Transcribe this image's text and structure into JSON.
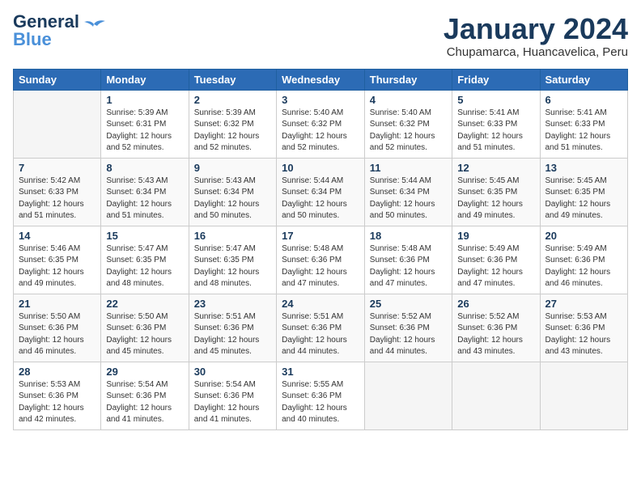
{
  "logo": {
    "line1": "General",
    "line2": "Blue"
  },
  "title": "January 2024",
  "location": "Chupamarca, Huancavelica, Peru",
  "weekdays": [
    "Sunday",
    "Monday",
    "Tuesday",
    "Wednesday",
    "Thursday",
    "Friday",
    "Saturday"
  ],
  "weeks": [
    [
      {
        "day": "",
        "empty": true
      },
      {
        "day": "1",
        "sunrise": "5:39 AM",
        "sunset": "6:31 PM",
        "daylight": "12 hours and 52 minutes."
      },
      {
        "day": "2",
        "sunrise": "5:39 AM",
        "sunset": "6:32 PM",
        "daylight": "12 hours and 52 minutes."
      },
      {
        "day": "3",
        "sunrise": "5:40 AM",
        "sunset": "6:32 PM",
        "daylight": "12 hours and 52 minutes."
      },
      {
        "day": "4",
        "sunrise": "5:40 AM",
        "sunset": "6:32 PM",
        "daylight": "12 hours and 52 minutes."
      },
      {
        "day": "5",
        "sunrise": "5:41 AM",
        "sunset": "6:33 PM",
        "daylight": "12 hours and 51 minutes."
      },
      {
        "day": "6",
        "sunrise": "5:41 AM",
        "sunset": "6:33 PM",
        "daylight": "12 hours and 51 minutes."
      }
    ],
    [
      {
        "day": "7",
        "sunrise": "5:42 AM",
        "sunset": "6:33 PM",
        "daylight": "12 hours and 51 minutes."
      },
      {
        "day": "8",
        "sunrise": "5:43 AM",
        "sunset": "6:34 PM",
        "daylight": "12 hours and 51 minutes."
      },
      {
        "day": "9",
        "sunrise": "5:43 AM",
        "sunset": "6:34 PM",
        "daylight": "12 hours and 50 minutes."
      },
      {
        "day": "10",
        "sunrise": "5:44 AM",
        "sunset": "6:34 PM",
        "daylight": "12 hours and 50 minutes."
      },
      {
        "day": "11",
        "sunrise": "5:44 AM",
        "sunset": "6:34 PM",
        "daylight": "12 hours and 50 minutes."
      },
      {
        "day": "12",
        "sunrise": "5:45 AM",
        "sunset": "6:35 PM",
        "daylight": "12 hours and 49 minutes."
      },
      {
        "day": "13",
        "sunrise": "5:45 AM",
        "sunset": "6:35 PM",
        "daylight": "12 hours and 49 minutes."
      }
    ],
    [
      {
        "day": "14",
        "sunrise": "5:46 AM",
        "sunset": "6:35 PM",
        "daylight": "12 hours and 49 minutes."
      },
      {
        "day": "15",
        "sunrise": "5:47 AM",
        "sunset": "6:35 PM",
        "daylight": "12 hours and 48 minutes."
      },
      {
        "day": "16",
        "sunrise": "5:47 AM",
        "sunset": "6:35 PM",
        "daylight": "12 hours and 48 minutes."
      },
      {
        "day": "17",
        "sunrise": "5:48 AM",
        "sunset": "6:36 PM",
        "daylight": "12 hours and 47 minutes."
      },
      {
        "day": "18",
        "sunrise": "5:48 AM",
        "sunset": "6:36 PM",
        "daylight": "12 hours and 47 minutes."
      },
      {
        "day": "19",
        "sunrise": "5:49 AM",
        "sunset": "6:36 PM",
        "daylight": "12 hours and 47 minutes."
      },
      {
        "day": "20",
        "sunrise": "5:49 AM",
        "sunset": "6:36 PM",
        "daylight": "12 hours and 46 minutes."
      }
    ],
    [
      {
        "day": "21",
        "sunrise": "5:50 AM",
        "sunset": "6:36 PM",
        "daylight": "12 hours and 46 minutes."
      },
      {
        "day": "22",
        "sunrise": "5:50 AM",
        "sunset": "6:36 PM",
        "daylight": "12 hours and 45 minutes."
      },
      {
        "day": "23",
        "sunrise": "5:51 AM",
        "sunset": "6:36 PM",
        "daylight": "12 hours and 45 minutes."
      },
      {
        "day": "24",
        "sunrise": "5:51 AM",
        "sunset": "6:36 PM",
        "daylight": "12 hours and 44 minutes."
      },
      {
        "day": "25",
        "sunrise": "5:52 AM",
        "sunset": "6:36 PM",
        "daylight": "12 hours and 44 minutes."
      },
      {
        "day": "26",
        "sunrise": "5:52 AM",
        "sunset": "6:36 PM",
        "daylight": "12 hours and 43 minutes."
      },
      {
        "day": "27",
        "sunrise": "5:53 AM",
        "sunset": "6:36 PM",
        "daylight": "12 hours and 43 minutes."
      }
    ],
    [
      {
        "day": "28",
        "sunrise": "5:53 AM",
        "sunset": "6:36 PM",
        "daylight": "12 hours and 42 minutes."
      },
      {
        "day": "29",
        "sunrise": "5:54 AM",
        "sunset": "6:36 PM",
        "daylight": "12 hours and 41 minutes."
      },
      {
        "day": "30",
        "sunrise": "5:54 AM",
        "sunset": "6:36 PM",
        "daylight": "12 hours and 41 minutes."
      },
      {
        "day": "31",
        "sunrise": "5:55 AM",
        "sunset": "6:36 PM",
        "daylight": "12 hours and 40 minutes."
      },
      {
        "day": "",
        "empty": true
      },
      {
        "day": "",
        "empty": true
      },
      {
        "day": "",
        "empty": true
      }
    ]
  ]
}
